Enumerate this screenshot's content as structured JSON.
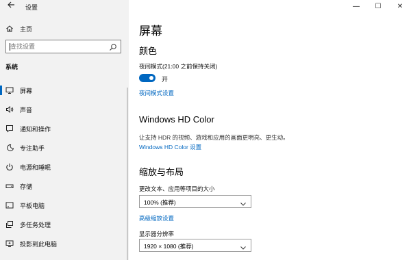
{
  "app": {
    "title": "设置"
  },
  "window_controls": {
    "minimize": "—",
    "maximize": "☐",
    "close": "✕"
  },
  "sidebar": {
    "home_label": "主页",
    "search": {
      "placeholder": "查找设置",
      "value": ""
    },
    "section_title": "系统",
    "items": [
      {
        "label": "屏幕",
        "icon": "monitor-icon",
        "active": true
      },
      {
        "label": "声音",
        "icon": "speaker-icon"
      },
      {
        "label": "通知和操作",
        "icon": "notification-icon"
      },
      {
        "label": "专注助手",
        "icon": "moon-icon"
      },
      {
        "label": "电源和睡眠",
        "icon": "power-icon"
      },
      {
        "label": "存储",
        "icon": "storage-icon"
      },
      {
        "label": "平板电脑",
        "icon": "tablet-icon"
      },
      {
        "label": "多任务处理",
        "icon": "multitasking-icon"
      },
      {
        "label": "投影到此电脑",
        "icon": "projection-icon"
      }
    ]
  },
  "main": {
    "title": "屏幕",
    "color": {
      "heading": "颜色",
      "night_mode_label": "夜间模式(21:00 之前保持关闭)",
      "toggle_state": "开",
      "toggle_on": true,
      "settings_link": "夜间模式设置"
    },
    "hd_color": {
      "heading": "Windows HD Color",
      "description": "让支持 HDR 的视频、游戏和应用的画面更明亮、更生动。",
      "settings_link": "Windows HD Color 设置"
    },
    "scale_layout": {
      "heading": "缩放与布局",
      "scale_label": "更改文本、应用等项目的大小",
      "scale_value": "100% (推荐)",
      "advanced_link": "高级缩放设置",
      "resolution_label": "显示器分辨率",
      "resolution_value": "1920 × 1080 (推荐)"
    }
  },
  "colors": {
    "accent": "#0067c0",
    "sidebar_bg": "#f2f2f2",
    "link": "#0067c0"
  }
}
